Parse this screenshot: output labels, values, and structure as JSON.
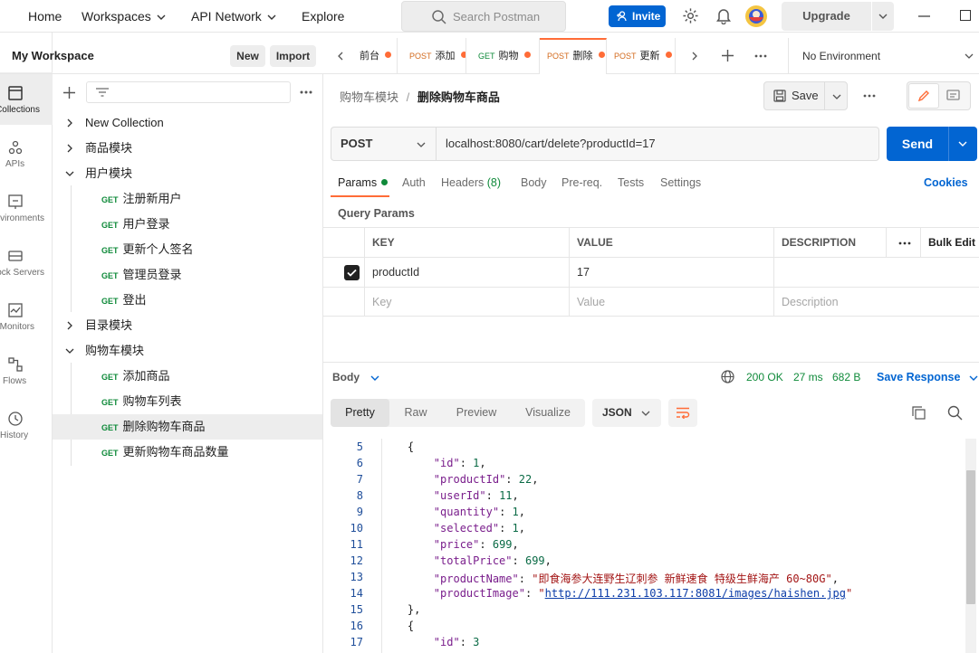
{
  "topbar": {
    "nav": [
      "Home",
      "Workspaces",
      "API Network",
      "Explore"
    ],
    "search_placeholder": "Search Postman",
    "invite_label": "Invite",
    "upgrade_label": "Upgrade"
  },
  "rail": {
    "items": [
      {
        "label": "Collections",
        "icon": "collections-icon"
      },
      {
        "label": "APIs",
        "icon": "apis-icon"
      },
      {
        "label": "Environments",
        "icon": "environments-icon"
      },
      {
        "label": "Mock Servers",
        "icon": "mock-servers-icon"
      },
      {
        "label": "Monitors",
        "icon": "monitors-icon"
      },
      {
        "label": "Flows",
        "icon": "flows-icon"
      },
      {
        "label": "History",
        "icon": "history-icon"
      }
    ]
  },
  "sidebar": {
    "workspace_title": "My Workspace",
    "new_label": "New",
    "import_label": "Import",
    "tree": [
      {
        "label": "New Collection",
        "type": "collection"
      },
      {
        "label": "商品模块",
        "type": "collection"
      },
      {
        "label": "用户模块",
        "type": "collection-open"
      },
      {
        "label": "注册新用户",
        "method": "GET",
        "type": "request"
      },
      {
        "label": "用户登录",
        "method": "GET",
        "type": "request"
      },
      {
        "label": "更新个人签名",
        "method": "GET",
        "type": "request"
      },
      {
        "label": "管理员登录",
        "method": "GET",
        "type": "request"
      },
      {
        "label": "登出",
        "method": "GET",
        "type": "request"
      },
      {
        "label": "目录模块",
        "type": "collection"
      },
      {
        "label": "购物车模块",
        "type": "collection-open"
      },
      {
        "label": "添加商品",
        "method": "GET",
        "type": "request"
      },
      {
        "label": "购物车列表",
        "method": "GET",
        "type": "request"
      },
      {
        "label": "删除购物车商品",
        "method": "GET",
        "type": "request",
        "selected": true
      },
      {
        "label": "更新购物车商品数量",
        "method": "GET",
        "type": "request"
      }
    ]
  },
  "tabs": {
    "items": [
      {
        "method": "",
        "label": "前台"
      },
      {
        "method": "POST",
        "label": "添加"
      },
      {
        "method": "GET",
        "label": "购物"
      },
      {
        "method": "POST",
        "label": "删除",
        "active": true
      },
      {
        "method": "POST",
        "label": "更新"
      }
    ],
    "environment": "No Environment"
  },
  "request": {
    "breadcrumb_parent": "购物车模块",
    "breadcrumb_sep": "/",
    "breadcrumb_current": "删除购物车商品",
    "save_label": "Save",
    "method": "POST",
    "url": "localhost:8080/cart/delete?productId=17",
    "send_label": "Send",
    "subtabs": [
      "Params",
      "Auth",
      "Headers",
      "Body",
      "Pre-req.",
      "Tests",
      "Settings"
    ],
    "headers_count": "(8)",
    "cookies_label": "Cookies",
    "query_params_label": "Query Params",
    "table": {
      "headers": [
        "KEY",
        "VALUE",
        "DESCRIPTION"
      ],
      "bulk_edit": "Bulk Edit",
      "rows": [
        {
          "checked": true,
          "key": "productId",
          "value": "17",
          "description": ""
        }
      ],
      "placeholders": {
        "key": "Key",
        "value": "Value",
        "description": "Description"
      }
    }
  },
  "response": {
    "body_label": "Body",
    "status": "200 OK",
    "time": "27 ms",
    "size": "682 B",
    "save_response_label": "Save Response",
    "formats": [
      "Pretty",
      "Raw",
      "Preview",
      "Visualize"
    ],
    "language": "JSON",
    "lines": [
      {
        "n": "5",
        "indent": 4,
        "text": "{"
      },
      {
        "n": "6",
        "indent": 8,
        "key": "id",
        "num": "1"
      },
      {
        "n": "7",
        "indent": 8,
        "key": "productId",
        "num": "22"
      },
      {
        "n": "8",
        "indent": 8,
        "key": "userId",
        "num": "11"
      },
      {
        "n": "9",
        "indent": 8,
        "key": "quantity",
        "num": "1"
      },
      {
        "n": "10",
        "indent": 8,
        "key": "selected",
        "num": "1"
      },
      {
        "n": "11",
        "indent": 8,
        "key": "price",
        "num": "699"
      },
      {
        "n": "12",
        "indent": 8,
        "key": "totalPrice",
        "num": "699"
      },
      {
        "n": "13",
        "indent": 8,
        "key": "productName",
        "str": "即食海参大连野生辽刺参 新鲜速食 特级生鲜海产 60~80G"
      },
      {
        "n": "14",
        "indent": 8,
        "key": "productImage",
        "url": "http://111.231.103.117:8081/images/haishen.jpg"
      },
      {
        "n": "15",
        "indent": 4,
        "text": "},"
      },
      {
        "n": "16",
        "indent": 4,
        "text": "{"
      },
      {
        "n": "17",
        "indent": 8,
        "key": "id",
        "num": "3"
      }
    ]
  },
  "colors": {
    "accent": "#ff6c37",
    "primary": "#0265d2",
    "status_ok": "#0f8a3a"
  }
}
